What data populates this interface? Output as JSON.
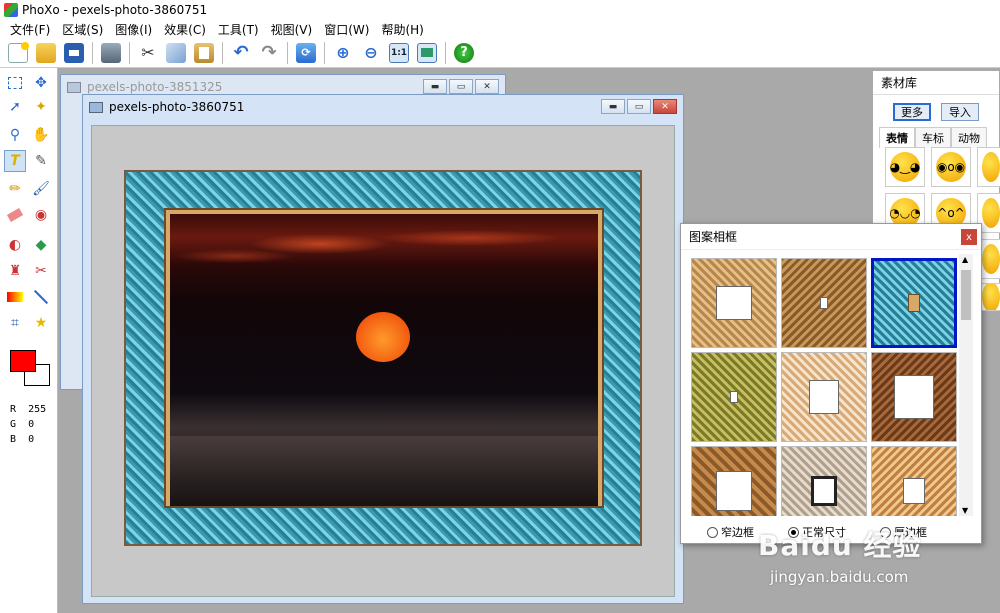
{
  "app": {
    "title": "PhoXo - pexels-photo-3860751"
  },
  "menu": [
    "文件(F)",
    "区域(S)",
    "图像(I)",
    "效果(C)",
    "工具(T)",
    "视图(V)",
    "窗口(W)",
    "帮助(H)"
  ],
  "toolbar": {
    "buttons": [
      "new-icon",
      "open-icon",
      "save-icon",
      "print-icon",
      "cut-icon",
      "copy-icon",
      "paste-icon",
      "undo-icon",
      "redo-icon",
      "refresh-icon",
      "zoom-in-icon",
      "zoom-out-icon",
      "actual-size-icon",
      "fit-window-icon",
      "help-icon"
    ],
    "actual_size_label": "1:1",
    "help_label": "?"
  },
  "colors": {
    "foreground": "#ff0000",
    "background": "#ffffff"
  },
  "rgb": {
    "r_label": "R",
    "r": "255",
    "g_label": "G",
    "g": "0",
    "b_label": "B",
    "b": "0"
  },
  "windows": {
    "back_title": "pexels-photo-3851325",
    "front_title": "pexels-photo-3860751"
  },
  "material_panel": {
    "title": "素材库",
    "more_button": "更多",
    "import_button": "导入",
    "tabs": [
      "表情",
      "车标",
      "动物"
    ]
  },
  "frame_dialog": {
    "title": "图案相框",
    "close": "x",
    "selected_index": 2,
    "options": [
      "窄边框",
      "正常尺寸",
      "厚边框"
    ],
    "selected_option": 1
  },
  "watermark": {
    "brand": "Baidu 经验",
    "url": "jingyan.baidu.com"
  }
}
